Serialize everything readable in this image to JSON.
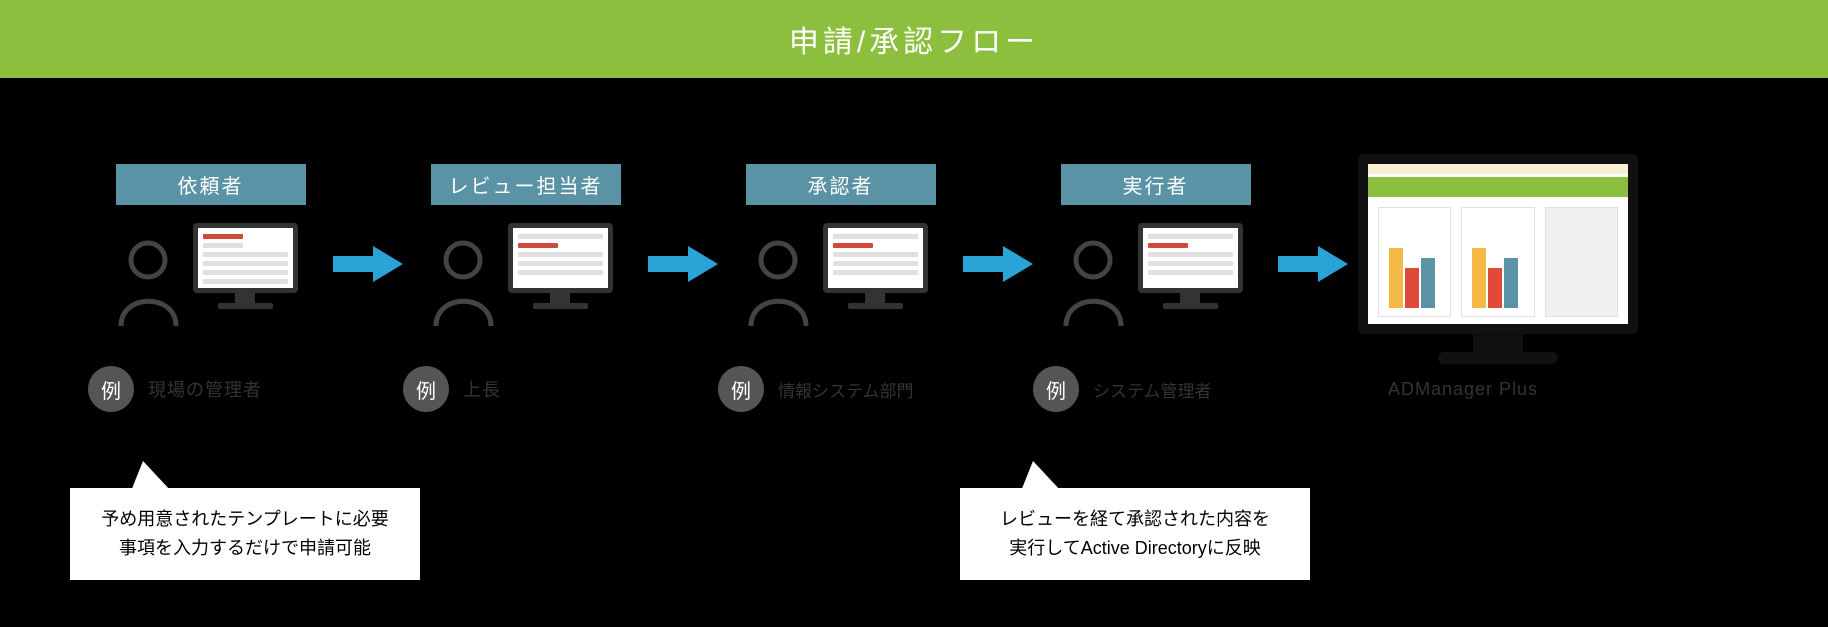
{
  "header": {
    "title": "申請/承認フロー"
  },
  "stages": [
    {
      "role": "依頼者",
      "example_label": "例",
      "example_text": "現場の管理者"
    },
    {
      "role": "レビュー担当者",
      "example_label": "例",
      "example_text": "上長"
    },
    {
      "role": "承認者",
      "example_label": "例",
      "example_text": "情報システム部門"
    },
    {
      "role": "実行者",
      "example_label": "例",
      "example_text": "システム管理者"
    }
  ],
  "final": {
    "product_text": "ADManager Plus"
  },
  "callouts": {
    "left": "予め用意されたテンプレートに必要\n事項を入力するだけで申請可能",
    "right": "レビューを経て承認された内容を\n実行してActive Directoryに反映"
  },
  "colors": {
    "header_bg": "#8dbf3f",
    "role_bg": "#5a93a6",
    "arrow": "#2aa3d6",
    "badge_bg": "#555555"
  }
}
